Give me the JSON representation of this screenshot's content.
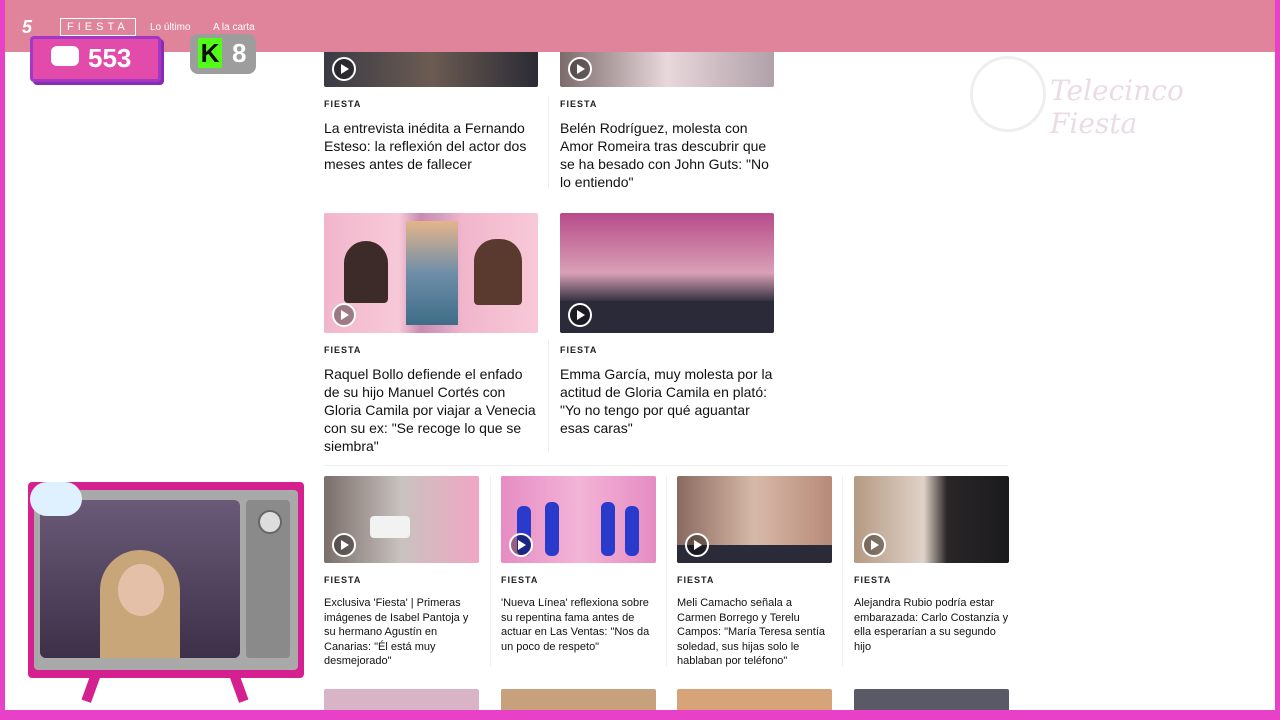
{
  "topbar": {
    "logo_channel": "5",
    "logo_fiesta": "FIESTA",
    "nav": [
      "Lo último",
      "A la carta"
    ]
  },
  "overlay": {
    "viewers_count": "553",
    "kick_count": "8",
    "kick_logo": "K",
    "watermark": "Telecinco Fiesta"
  },
  "articles": {
    "row1": [
      {
        "tag": "FIESTA",
        "title": "La entrevista inédita a Fernando Esteso: la reflexión del actor dos meses antes de fallecer"
      },
      {
        "tag": "FIESTA",
        "title": "Belén Rodríguez, molesta con Amor Romeira tras descubrir que se ha besado con John Guts: \"No lo entiendo\""
      }
    ],
    "row2": [
      {
        "tag": "FIESTA",
        "title": "Raquel Bollo defiende el enfado de su hijo Manuel Cortés con Gloria Camila por viajar a Venecia con su ex: \"Se recoge lo que se siembra\""
      },
      {
        "tag": "FIESTA",
        "title": "Emma García, muy molesta por la actitud de Gloria Camila en plató: \"Yo no tengo por qué aguantar esas caras\""
      }
    ],
    "row3": [
      {
        "tag": "FIESTA",
        "title": "Exclusiva 'Fiesta' | Primeras imágenes de Isabel Pantoja y su hermano Agustín en Canarias: \"Él está muy desmejorado\""
      },
      {
        "tag": "FIESTA",
        "title": "'Nueva Línea' reflexiona sobre su repentina fama antes de actuar en Las Ventas: \"Nos da un poco de respeto\""
      },
      {
        "tag": "FIESTA",
        "title": "Meli Camacho señala a Carmen Borrego y Terelu Campos: \"María Teresa sentía soledad, sus hijas solo le hablaban por teléfono\""
      },
      {
        "tag": "FIESTA",
        "title": "Alejandra Rubio podría estar embarazada: Carlo Costanzia y ella esperarían a su segundo hijo"
      }
    ]
  },
  "colors": {
    "topbar": "#e0849c",
    "frame": "#e940c8",
    "viewers_pill": "#e24ba9",
    "kick_green": "#53fc18"
  }
}
